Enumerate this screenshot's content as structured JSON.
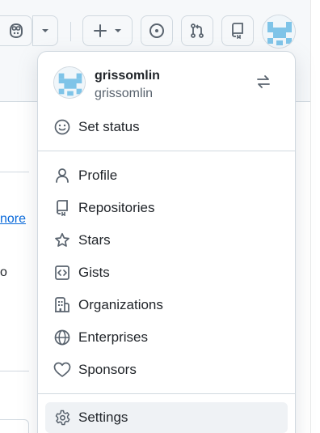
{
  "user": {
    "display_name": "grissomlin",
    "login": "grissomlin"
  },
  "header": {
    "icons": [
      "copilot-icon",
      "chevron-down-icon",
      "plus-icon",
      "issue-opened-icon",
      "git-pull-request-icon",
      "repo-icon",
      "avatar"
    ]
  },
  "background": {
    "link_fragment": "nore",
    "text_fragment": "o"
  },
  "menu": {
    "set_status": "Set status",
    "items": [
      {
        "label": "Profile",
        "icon": "person-icon"
      },
      {
        "label": "Repositories",
        "icon": "repo-icon"
      },
      {
        "label": "Stars",
        "icon": "star-icon"
      },
      {
        "label": "Gists",
        "icon": "code-square-icon"
      },
      {
        "label": "Organizations",
        "icon": "organization-icon"
      },
      {
        "label": "Enterprises",
        "icon": "globe-icon"
      },
      {
        "label": "Sponsors",
        "icon": "heart-icon"
      }
    ],
    "settings": "Settings"
  },
  "colors": {
    "link": "#0969da",
    "text": "#1f2328",
    "muted": "#59636e",
    "border": "#d1d9e0",
    "avatar_blue": "#7fc4e8"
  }
}
